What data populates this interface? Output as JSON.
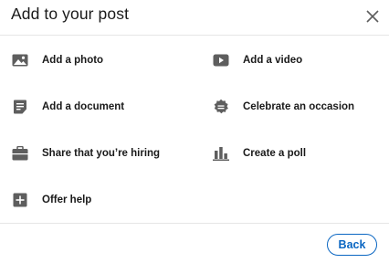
{
  "header": {
    "title": "Add to your post",
    "close_icon": "close-icon"
  },
  "options": {
    "photo": {
      "label": "Add a photo",
      "icon": "photo-icon"
    },
    "video": {
      "label": "Add a video",
      "icon": "video-icon"
    },
    "document": {
      "label": "Add a document",
      "icon": "document-icon"
    },
    "occasion": {
      "label": "Celebrate an occasion",
      "icon": "celebrate-icon"
    },
    "hiring": {
      "label": "Share that you’re hiring",
      "icon": "briefcase-icon"
    },
    "poll": {
      "label": "Create a poll",
      "icon": "poll-icon"
    },
    "help": {
      "label": "Offer help",
      "icon": "plus-box-icon"
    }
  },
  "footer": {
    "back_label": "Back"
  },
  "colors": {
    "accent": "#0a66c2",
    "icon": "#5e5e5e",
    "text": "#191919"
  }
}
